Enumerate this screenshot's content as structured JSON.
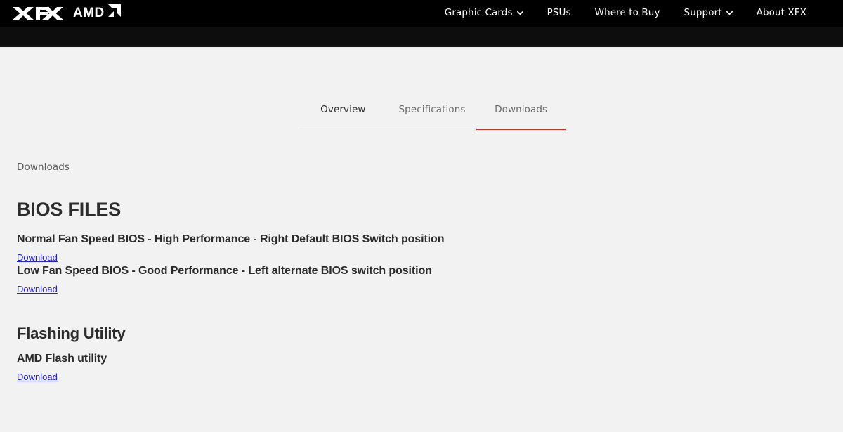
{
  "header": {
    "logo_xfx": "XFX",
    "logo_amd": "AMD",
    "nav": [
      {
        "label": "Graphic Cards",
        "has_caret": true,
        "icon": "chevron-down-icon"
      },
      {
        "label": "PSUs",
        "has_caret": false,
        "icon": ""
      },
      {
        "label": "Where to Buy",
        "has_caret": false,
        "icon": ""
      },
      {
        "label": "Support",
        "has_caret": true,
        "icon": "chevron-down-icon"
      },
      {
        "label": "About XFX",
        "has_caret": false,
        "icon": ""
      }
    ]
  },
  "tabs": [
    {
      "label": "Overview",
      "active": false
    },
    {
      "label": "Specifications",
      "active": false
    },
    {
      "label": "Downloads",
      "active": true
    }
  ],
  "page": {
    "breadcrumb": "Downloads"
  },
  "sections": [
    {
      "title": "BIOS FILES",
      "style": "uppercase",
      "files": [
        {
          "name": "Normal Fan Speed BIOS - High Performance - Right Default BIOS Switch position",
          "download_label": "Download"
        },
        {
          "name": "Low Fan Speed BIOS - Good Performance - Left alternate BIOS switch position",
          "download_label": "Download"
        }
      ]
    },
    {
      "title": "Flashing Utility",
      "style": "titlecase",
      "files": [
        {
          "name": "AMD Flash utility",
          "download_label": "Download"
        }
      ]
    }
  ],
  "colors": {
    "page_background": "#f2f2f2",
    "topbar_background": "#000000",
    "subbar_background": "#0d0d0d",
    "active_tab_accent": "#c0392b",
    "link": "#2222cc",
    "heading": "#2c2c2c"
  }
}
